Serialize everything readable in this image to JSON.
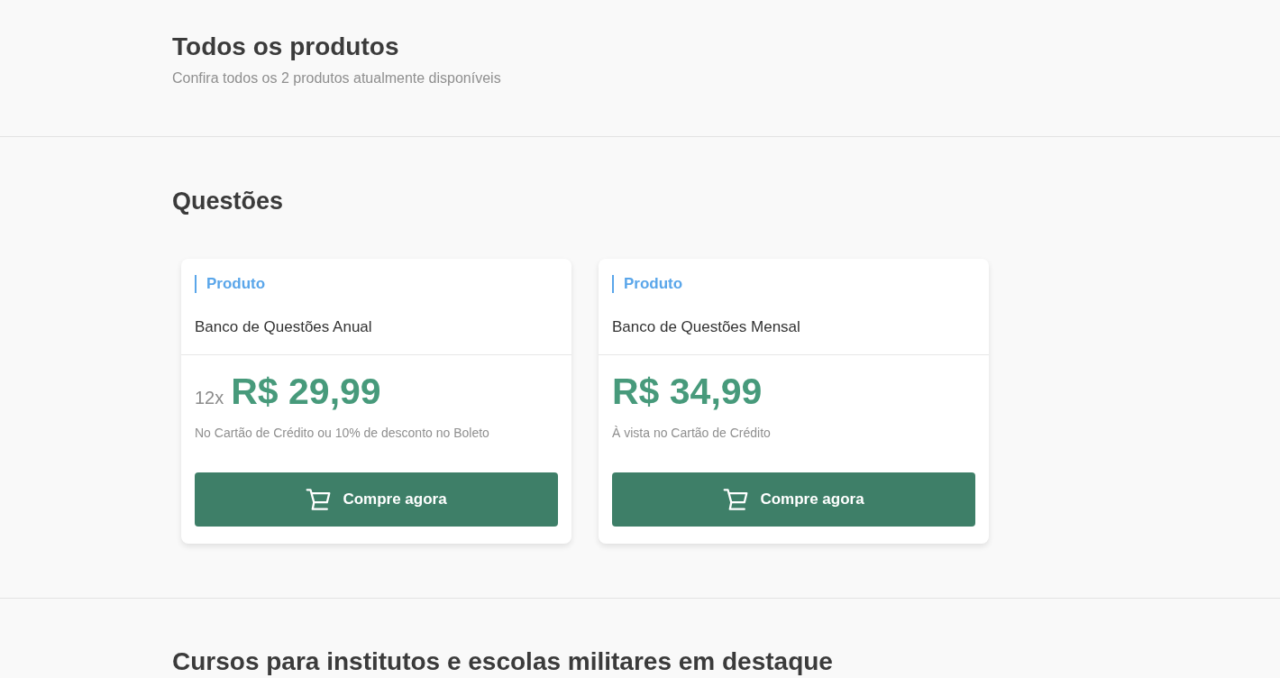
{
  "header": {
    "title": "Todos os produtos",
    "subtitle": "Confira todos os 2 produtos atualmente disponíveis"
  },
  "sections": [
    {
      "title": "Questões",
      "products": [
        {
          "tag": "Produto",
          "name": "Banco de Questões Anual",
          "installments": "12x",
          "price": "R$ 29,99",
          "note": "No Cartão de Crédito ou 10% de desconto no Boleto",
          "button": "Compre agora"
        },
        {
          "tag": "Produto",
          "name": "Banco de Questões Mensal",
          "price": "R$ 34,99",
          "note": "À vista no Cartão de Crédito",
          "button": "Compre agora"
        }
      ]
    },
    {
      "title": "Cursos para institutos e escolas militares em destaque"
    }
  ]
}
